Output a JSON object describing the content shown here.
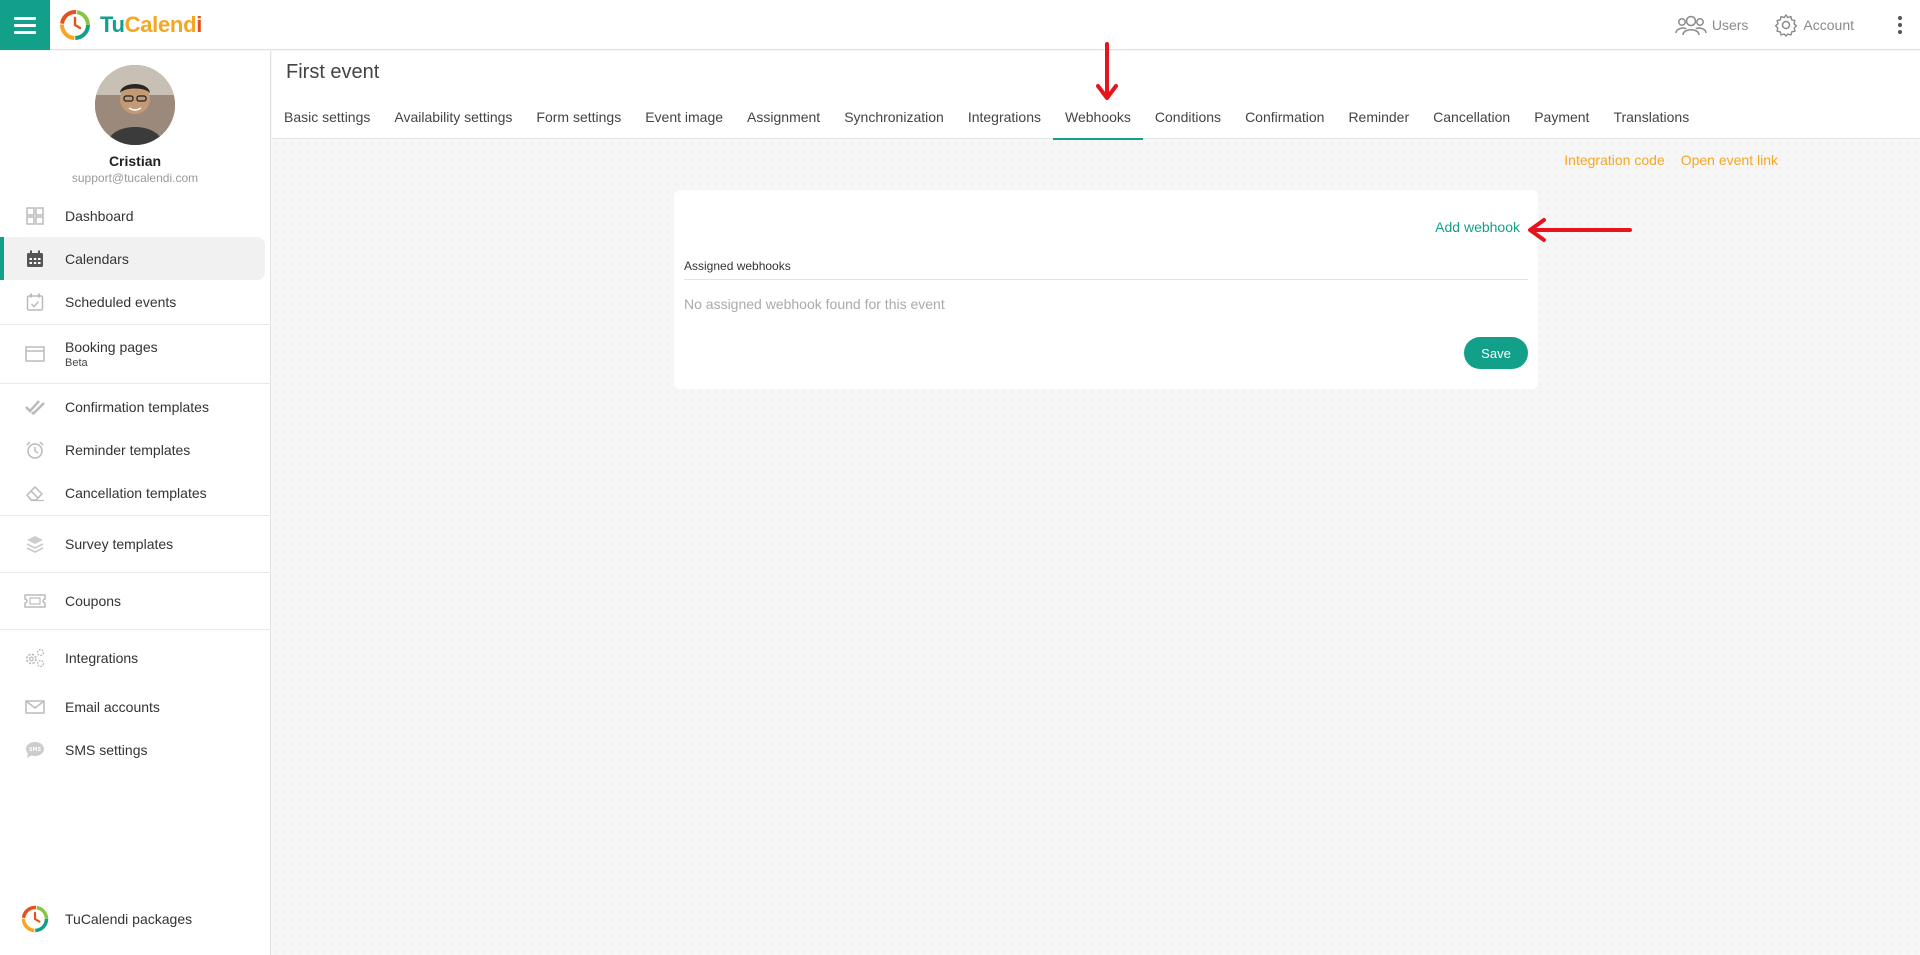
{
  "app": {
    "logo_parts": [
      "Tu",
      "Calend",
      "i"
    ]
  },
  "topbar": {
    "users_label": "Users",
    "account_label": "Account"
  },
  "profile": {
    "name": "Cristian",
    "email": "support@tucalendi.com"
  },
  "sidebar": {
    "items": [
      {
        "label": "Dashboard",
        "icon": "dashboard-icon"
      },
      {
        "label": "Calendars",
        "icon": "calendar-icon",
        "active": true
      },
      {
        "label": "Scheduled events",
        "icon": "calendar-check-icon"
      },
      {
        "label": "Booking pages",
        "sub": "Beta",
        "icon": "browser-window-icon"
      },
      {
        "label": "Confirmation templates",
        "icon": "double-check-icon"
      },
      {
        "label": "Reminder templates",
        "icon": "alarm-clock-icon"
      },
      {
        "label": "Cancellation templates",
        "icon": "eraser-icon"
      },
      {
        "label": "Survey templates",
        "icon": "layers-icon"
      },
      {
        "label": "Coupons",
        "icon": "ticket-icon"
      },
      {
        "label": "Integrations",
        "icon": "gears-icon"
      },
      {
        "label": "Email accounts",
        "icon": "envelope-icon"
      },
      {
        "label": "SMS settings",
        "icon": "sms-bubble-icon"
      }
    ],
    "packages_label": "TuCalendi packages"
  },
  "event": {
    "title": "First event",
    "tabs": [
      "Basic settings",
      "Availability settings",
      "Form settings",
      "Event image",
      "Assignment",
      "Synchronization",
      "Integrations",
      "Webhooks",
      "Conditions",
      "Confirmation",
      "Reminder",
      "Cancellation",
      "Payment",
      "Translations"
    ],
    "active_tab": "Webhooks"
  },
  "content": {
    "integration_code_label": "Integration code",
    "open_event_link_label": "Open event link",
    "add_webhook_label": "Add webhook",
    "assigned_label": "Assigned webhooks",
    "empty_message": "No assigned webhook found for this event",
    "save_label": "Save"
  },
  "colors": {
    "accent": "#13a08a",
    "orange": "#f5a623",
    "annotation": "#e8141b"
  }
}
